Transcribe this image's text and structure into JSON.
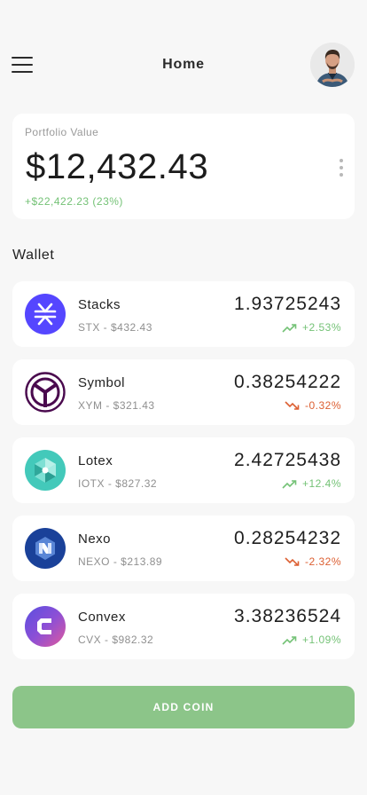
{
  "header": {
    "title": "Home",
    "menu_icon": "hamburger-menu-icon",
    "avatar_icon": "user-avatar"
  },
  "portfolio": {
    "label": "Portfolio Value",
    "value": "$12,432.43",
    "change": "+$22,422.23 (23%)",
    "more_icon": "kebab-menu-icon"
  },
  "wallet": {
    "title": "Wallet",
    "coins": [
      {
        "name": "Stacks",
        "sub": "STX - $432.43",
        "amount": "1.93725243",
        "change": "+2.53%",
        "trend": "up",
        "icon": "stacks-logo-icon",
        "color": "#5546ff"
      },
      {
        "name": "Symbol",
        "sub": "XYM - $321.43",
        "amount": "0.38254222",
        "change": "-0.32%",
        "trend": "down",
        "icon": "symbol-logo-icon",
        "color": "#4a0a4e"
      },
      {
        "name": "Lotex",
        "sub": "IOTX - $827.32",
        "amount": "2.42725438",
        "change": "+12.4%",
        "trend": "up",
        "icon": "iotex-logo-icon",
        "color": "#43c9ba"
      },
      {
        "name": "Nexo",
        "sub": "NEXO - $213.89",
        "amount": "0.28254232",
        "change": "-2.32%",
        "trend": "down",
        "icon": "nexo-logo-icon",
        "color": "#1a4199"
      },
      {
        "name": "Convex",
        "sub": "CVX - $982.32",
        "amount": "3.38236524",
        "change": "+1.09%",
        "trend": "up",
        "icon": "convex-logo-icon",
        "color": "#7c5ad6"
      }
    ]
  },
  "actions": {
    "add_coin": "ADD COIN"
  },
  "colors": {
    "positive": "#74c276",
    "negative": "#dc5f32",
    "button": "#8cc589",
    "background": "#f7f7f7"
  }
}
